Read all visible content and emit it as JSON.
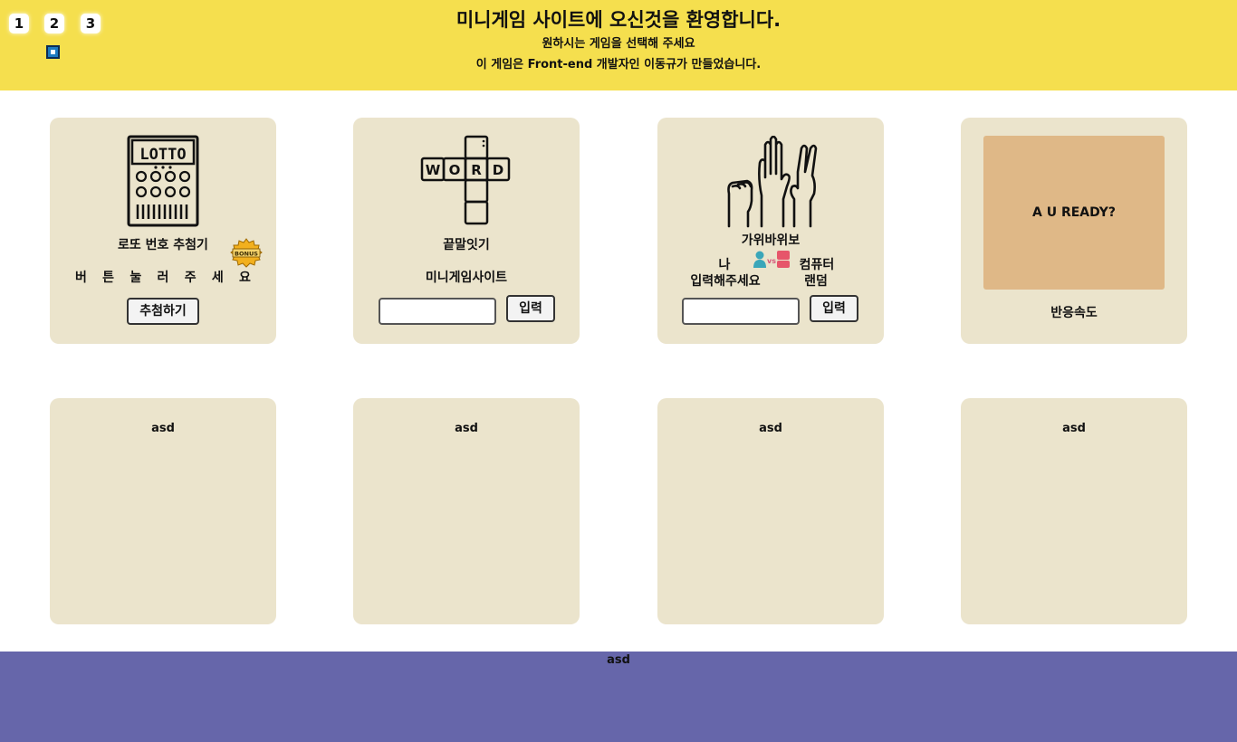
{
  "header": {
    "title": "미니게임 사이트에 오신것을 환영합니다.",
    "subtitle_1": "원하시는 게임을 선택해 주세요",
    "subtitle_2": "이 게임은 Front-end 개발자인 이동규가 만들었습니다.",
    "page_buttons": [
      "1",
      "2",
      "3"
    ],
    "accent": "#f5df4e"
  },
  "cards": {
    "lotto": {
      "icon_text": "LOTTO",
      "title": "로또 번호 추첨기",
      "prompt_chars": [
        "버",
        "튼",
        "눌",
        "러",
        "주",
        "세",
        "요"
      ],
      "badge": "BONUS",
      "button": "추첨하기"
    },
    "word": {
      "icon_letters": [
        "W",
        "O",
        "R",
        "D"
      ],
      "title": "끝말잇기",
      "word": "미니게임사이트",
      "input_value": "",
      "button": "입력"
    },
    "rps": {
      "title": "가위바위보",
      "me_label": "나",
      "me_prompt": "입력해주세요",
      "vs": "vs",
      "computer_label": "컴퓨터",
      "computer_value": "랜덤",
      "input_value": "",
      "button": "입력"
    },
    "reaction": {
      "box_text": "A U READY?",
      "title": "반응속도",
      "box_color": "#dfb887"
    },
    "placeholders": [
      "asd",
      "asd",
      "asd",
      "asd"
    ]
  },
  "footer": {
    "text": "asd",
    "color": "#6666aa"
  },
  "card_color": "#ebe4cc"
}
